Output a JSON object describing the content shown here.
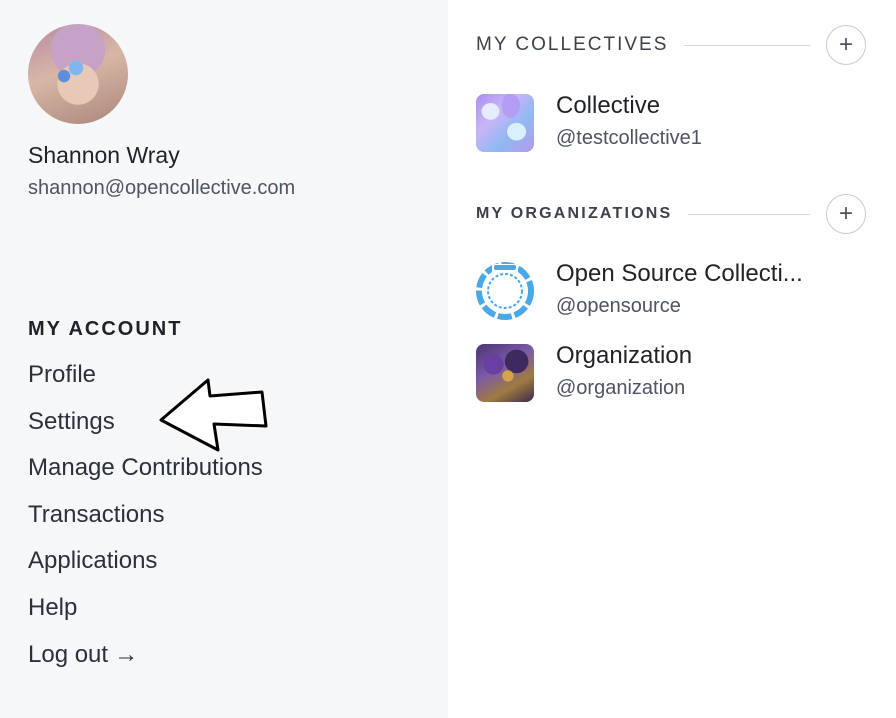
{
  "user": {
    "name": "Shannon Wray",
    "email": "shannon@opencollective.com"
  },
  "my_account": {
    "heading": "MY ACCOUNT",
    "items": [
      {
        "label": "Profile"
      },
      {
        "label": "Settings"
      },
      {
        "label": "Manage Contributions"
      },
      {
        "label": "Transactions"
      },
      {
        "label": "Applications"
      },
      {
        "label": "Help"
      },
      {
        "label": "Log out",
        "icon": "arrow-right-icon",
        "icon_glyph": "→"
      }
    ]
  },
  "collectives": {
    "heading": "MY COLLECTIVES",
    "add_label": "+",
    "items": [
      {
        "name": "Collective",
        "handle": "@testcollective1"
      }
    ]
  },
  "organizations": {
    "heading": "MY ORGANIZATIONS",
    "add_label": "+",
    "items": [
      {
        "name": "Open Source Collecti...",
        "handle": "@opensource"
      },
      {
        "name": "Organization",
        "handle": "@organization"
      }
    ]
  },
  "colors": {
    "left_panel_bg": "#f6f7f9",
    "osc_logo_blue": "#4aa8e8",
    "text_primary": "#1f2328",
    "text_secondary": "#4d5561"
  }
}
